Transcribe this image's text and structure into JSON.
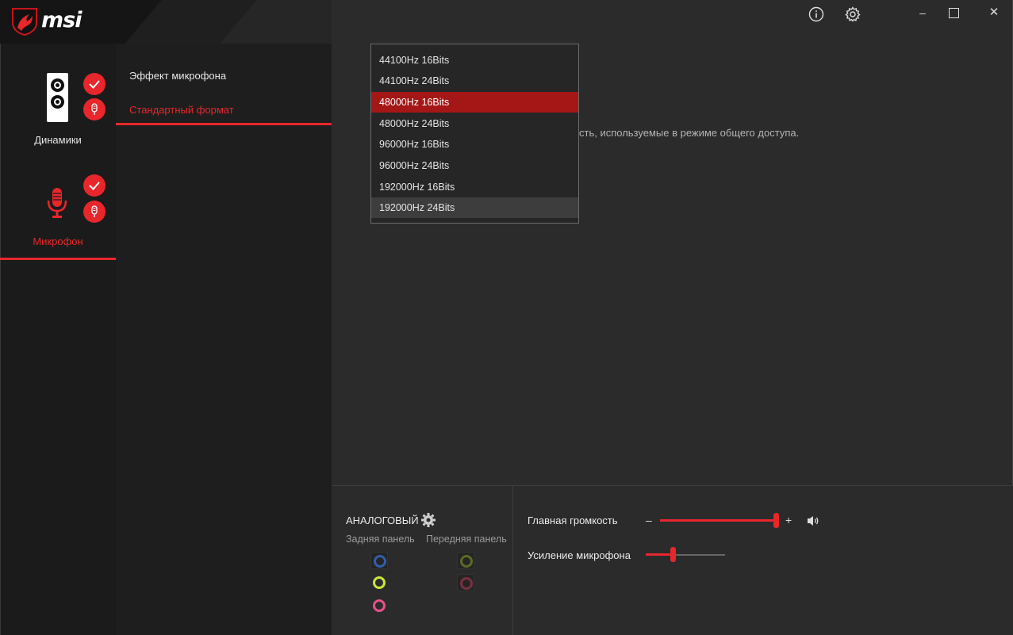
{
  "brand": {
    "name": "msi"
  },
  "window_controls": {
    "info_icon": "info-icon",
    "settings_icon": "gear-icon",
    "minimize": "–",
    "maximize": "☐",
    "close": "✕"
  },
  "devices": [
    {
      "label": "Динамики",
      "active": false
    },
    {
      "label": "Микрофон",
      "active": true
    }
  ],
  "menu": [
    {
      "label": "Эффект микрофона",
      "active": false
    },
    {
      "label": "Стандартный формат",
      "active": true
    }
  ],
  "main": {
    "partial_text": "сть, используемые в режиме общего доступа."
  },
  "format_dropdown": {
    "options": [
      "44100Hz 16Bits",
      "44100Hz 24Bits",
      "48000Hz 16Bits",
      "48000Hz 24Bits",
      "96000Hz 16Bits",
      "96000Hz 24Bits",
      "192000Hz 16Bits",
      "192000Hz 24Bits"
    ],
    "selected": "48000Hz 16Bits",
    "hovered": "192000Hz 24Bits"
  },
  "jacks": {
    "title": "АНАЛОГОВЫЙ",
    "rear_label": "Задняя панель",
    "front_label": "Передняя панель",
    "rear_colors": [
      "#2f5fa8",
      "#c8e63a",
      "#e8508a"
    ],
    "front_colors": [
      "#5a6a25",
      "#7a3040"
    ]
  },
  "volume": {
    "master_label": "Главная громкость",
    "minus": "–",
    "plus": "+",
    "master_level": 1.0,
    "mic_boost_label": "Усиление микрофона",
    "mic_boost_level": 0.33
  },
  "colors": {
    "accent": "#e8262b",
    "selected_bg": "#a51616"
  }
}
